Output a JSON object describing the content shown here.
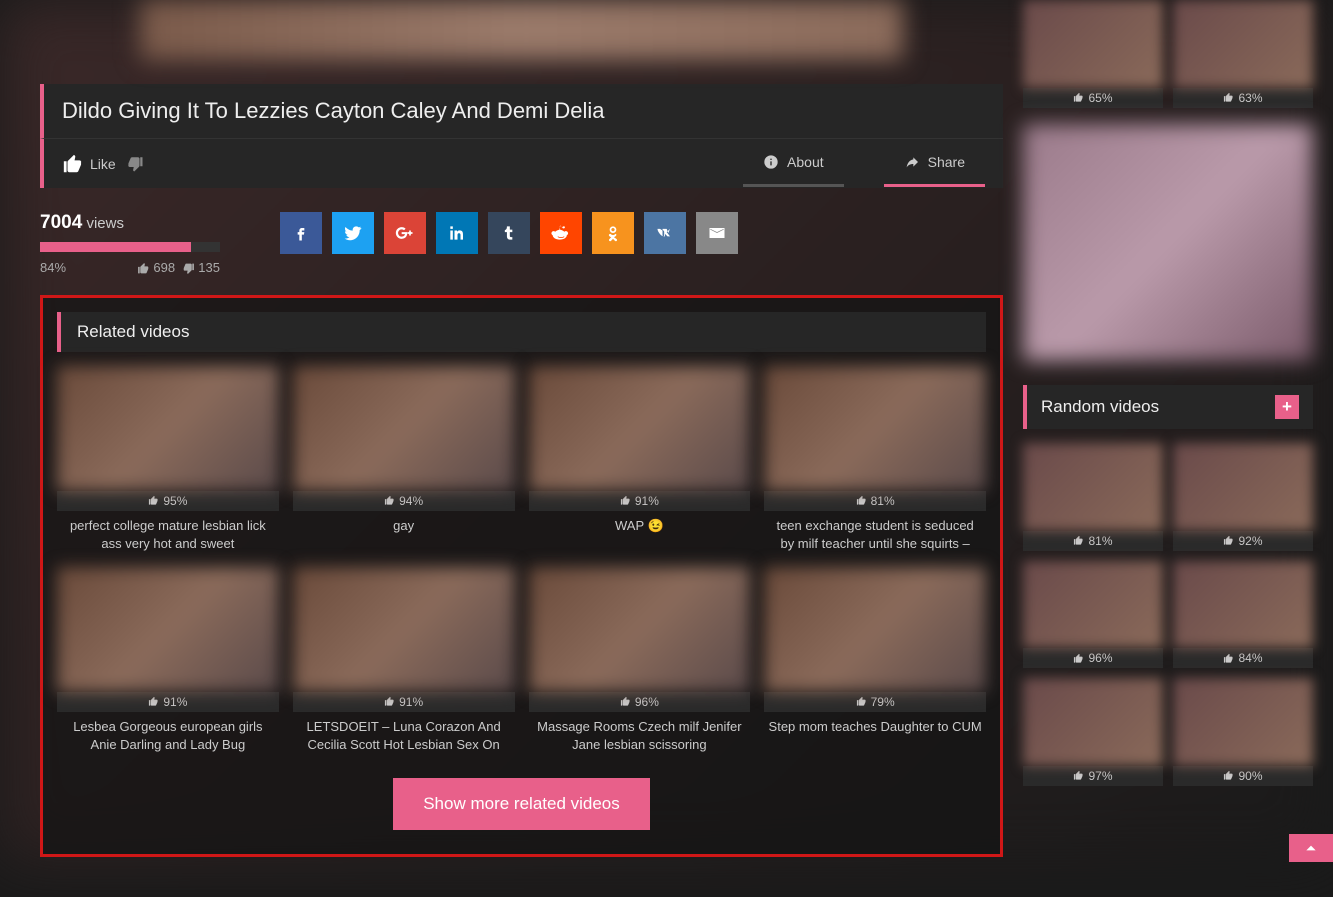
{
  "hero": {
    "title": "Dildo Giving It To Lezzies Cayton Caley And Demi Delia"
  },
  "actions": {
    "like_label": "Like",
    "about_label": "About",
    "share_label": "Share"
  },
  "stats": {
    "views": "7004",
    "views_label": "views",
    "percent": "84%",
    "bar_width": "84%",
    "likes": "698",
    "dislikes": "135"
  },
  "share_buttons": [
    {
      "name": "facebook",
      "cls": "sb-fb"
    },
    {
      "name": "twitter",
      "cls": "sb-tw"
    },
    {
      "name": "google-plus",
      "cls": "sb-gp"
    },
    {
      "name": "linkedin",
      "cls": "sb-li"
    },
    {
      "name": "tumblr",
      "cls": "sb-tb"
    },
    {
      "name": "reddit",
      "cls": "sb-rd"
    },
    {
      "name": "odnoklassniki",
      "cls": "sb-ok"
    },
    {
      "name": "vk",
      "cls": "sb-vk"
    },
    {
      "name": "email",
      "cls": "sb-em"
    }
  ],
  "related": {
    "header": "Related videos",
    "more_label": "Show more related videos",
    "items": [
      {
        "rating": "95%",
        "title": "perfect college mature lesbian lick ass very hot and sweet"
      },
      {
        "rating": "94%",
        "title": "gay"
      },
      {
        "rating": "91%",
        "title": "WAP 😉"
      },
      {
        "rating": "81%",
        "title": "teen exchange student is seduced by milf teacher until she squirts –"
      },
      {
        "rating": "91%",
        "title": "Lesbea Gorgeous european girls Anie Darling and Lady Bug"
      },
      {
        "rating": "91%",
        "title": "LETSDOEIT – Luna Corazon And Cecilia Scott Hot Lesbian Sex On"
      },
      {
        "rating": "96%",
        "title": "Massage Rooms Czech milf Jenifer Jane lesbian scissoring"
      },
      {
        "rating": "79%",
        "title": "Step mom teaches Daughter to CUM"
      }
    ]
  },
  "sidebar": {
    "top_items": [
      {
        "rating": "65%"
      },
      {
        "rating": "63%"
      }
    ],
    "random_header": "Random videos",
    "random_items": [
      {
        "rating": "81%"
      },
      {
        "rating": "92%"
      },
      {
        "rating": "96%"
      },
      {
        "rating": "84%"
      },
      {
        "rating": "97%"
      },
      {
        "rating": "90%"
      }
    ]
  }
}
